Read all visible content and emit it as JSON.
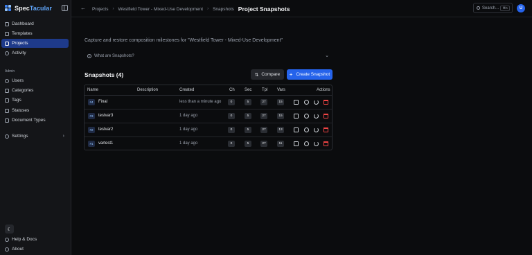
{
  "brand": {
    "name_part1": "Spec",
    "name_part2": "Tacular"
  },
  "sidebar": {
    "items": [
      {
        "label": "Dashboard",
        "icon": "dashboard-icon"
      },
      {
        "label": "Templates",
        "icon": "templates-icon"
      },
      {
        "label": "Projects",
        "icon": "projects-icon",
        "active": true
      },
      {
        "label": "Activity",
        "icon": "activity-icon"
      }
    ],
    "admin_label": "Admin",
    "admin_items": [
      {
        "label": "Users",
        "icon": "users-icon"
      },
      {
        "label": "Categories",
        "icon": "categories-icon"
      },
      {
        "label": "Tags",
        "icon": "tags-icon"
      },
      {
        "label": "Statuses",
        "icon": "statuses-icon"
      },
      {
        "label": "Document Types",
        "icon": "document-types-icon"
      }
    ],
    "settings_label": "Settings",
    "footer": [
      {
        "label": "Help & Docs",
        "icon": "help-icon"
      },
      {
        "label": "About",
        "icon": "info-icon"
      }
    ]
  },
  "header": {
    "breadcrumbs": [
      "Projects",
      "Westfield Tower - Mixed-Use Development",
      "Snapshots"
    ],
    "title": "Project Snapshots",
    "search_placeholder": "Search...",
    "search_shortcut": "⌘K",
    "avatar_initial": "U"
  },
  "main": {
    "intro": "Capture and restore composition milestones for \"Westfield Tower - Mixed-Use Development\"",
    "what_are": "What are Snapshots?",
    "snapshots_title": "Snapshots (4)",
    "compare_label": "Compare",
    "create_label": "Create Snapshot"
  },
  "table": {
    "columns": [
      "Name",
      "Description",
      "Created",
      "Ch",
      "Sec",
      "Tpl",
      "Vars",
      "Actions"
    ],
    "rows": [
      {
        "id": "#4",
        "name": "Final",
        "description": "",
        "created": "less than a minute ago",
        "ch": "0",
        "sec": "5",
        "tpl": "27",
        "vars": "15"
      },
      {
        "id": "#3",
        "name": "testvar3",
        "description": "",
        "created": "1 day ago",
        "ch": "0",
        "sec": "5",
        "tpl": "27",
        "vars": "15"
      },
      {
        "id": "#2",
        "name": "testvar2",
        "description": "",
        "created": "1 day ago",
        "ch": "0",
        "sec": "5",
        "tpl": "27",
        "vars": "13"
      },
      {
        "id": "#1",
        "name": "vartest1",
        "description": "",
        "created": "1 day ago",
        "ch": "0",
        "sec": "5",
        "tpl": "27",
        "vars": "11"
      }
    ]
  },
  "colors": {
    "accent": "#2563eb",
    "active_nav": "#1e3a8a",
    "danger": "#ef4444",
    "background": "#0b0c0e"
  }
}
